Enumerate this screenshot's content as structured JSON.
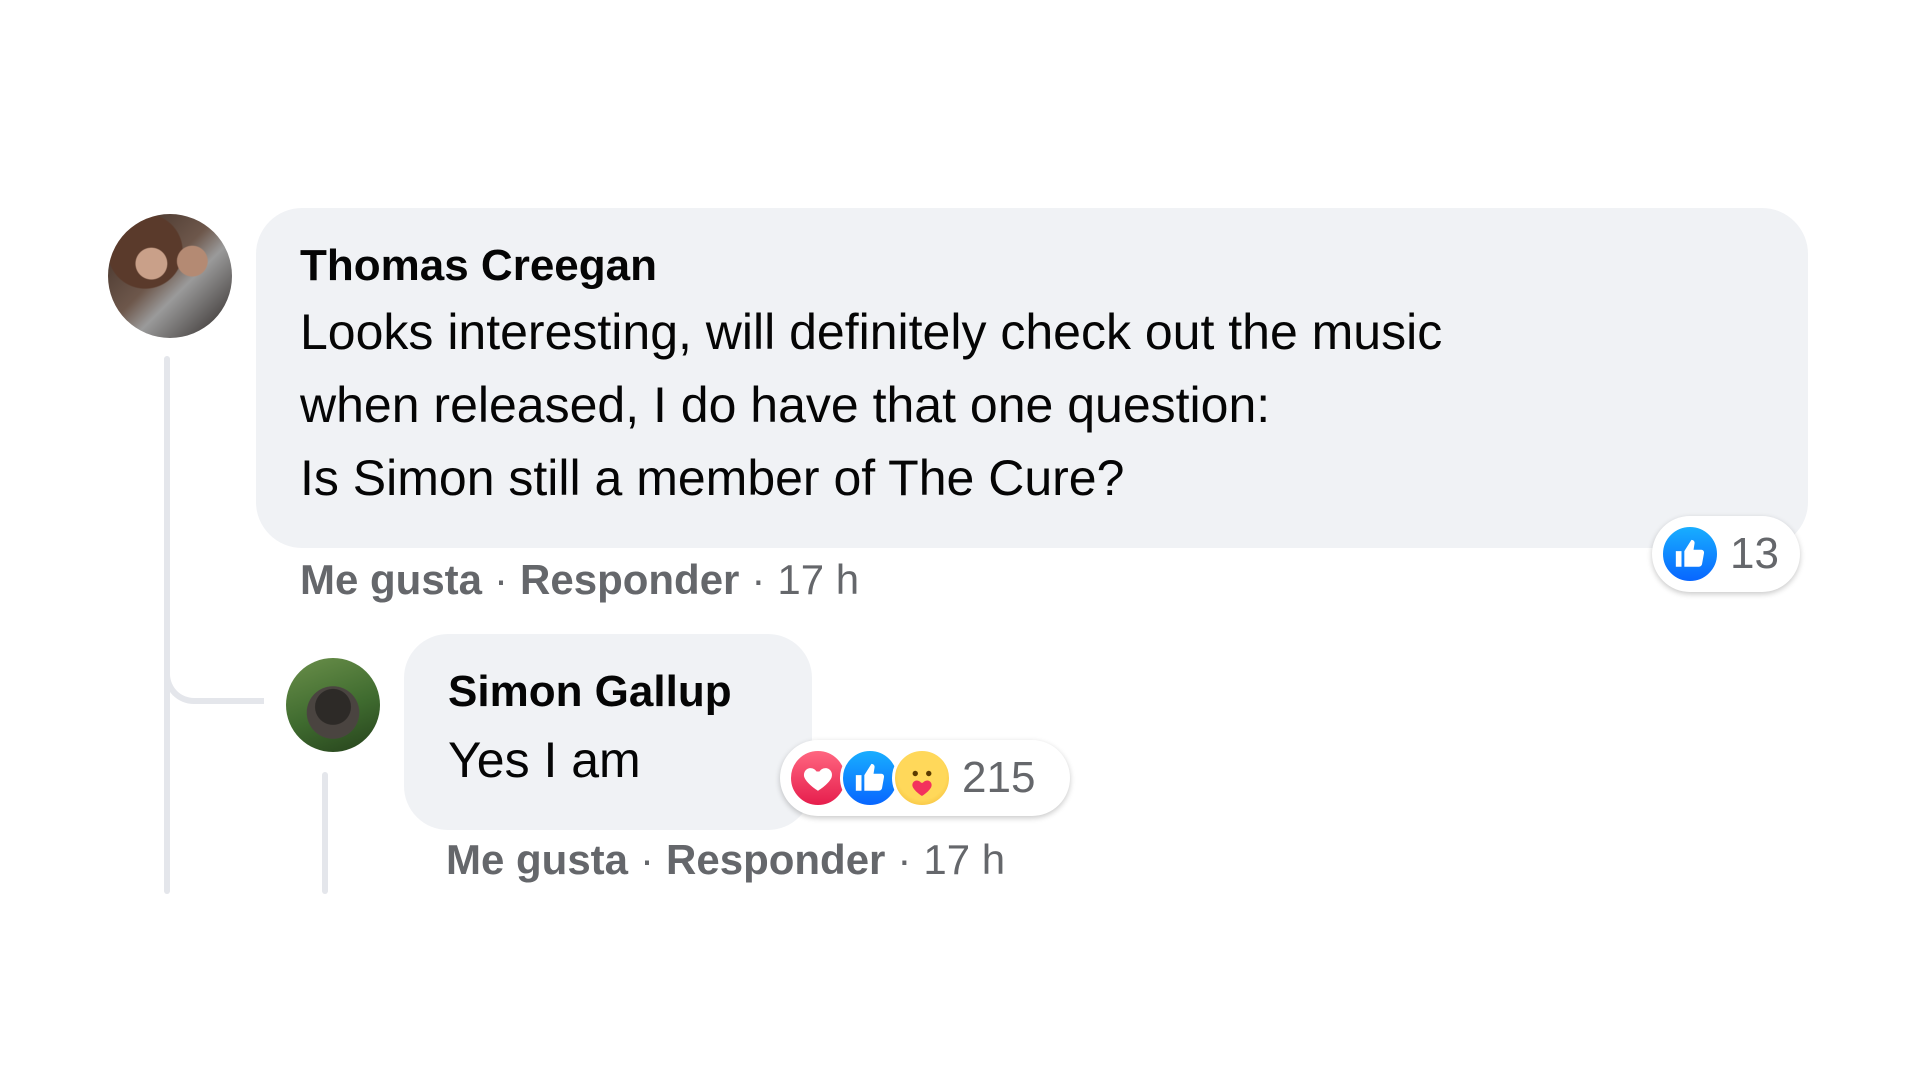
{
  "comment": {
    "author": "Thomas Creegan",
    "text": "Looks interesting, will definitely check out the music\nwhen released, I do have that one question:\nIs Simon still a member of The Cure?",
    "reactions": {
      "icons": [
        "like-icon"
      ],
      "count": "13"
    },
    "actions": {
      "like": "Me gusta",
      "reply": "Responder",
      "separator": "·",
      "time": "17 h"
    }
  },
  "reply": {
    "author": "Simon Gallup",
    "text": "Yes I am",
    "reactions": {
      "icons": [
        "love-icon",
        "like-icon",
        "care-icon"
      ],
      "count": "215"
    },
    "actions": {
      "like": "Me gusta",
      "reply": "Responder",
      "separator": "·",
      "time": "17 h"
    }
  },
  "colors": {
    "bubble": "#f0f2f5",
    "meta_text": "#65676b",
    "like_blue": "#0866ff",
    "love_red": "#e61e4d",
    "care_yellow": "#ffd85a"
  }
}
